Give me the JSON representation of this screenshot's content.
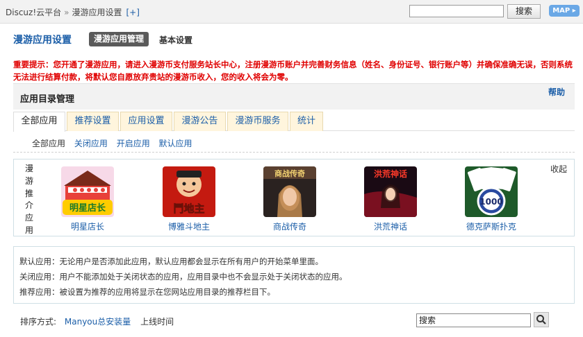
{
  "topbar": {
    "breadcrumb_root": "Discuz!云平台",
    "breadcrumb_sep": "»",
    "breadcrumb_current": "漫游应用设置",
    "add_label": "[+]",
    "search_placeholder": "",
    "search_button": "搜索",
    "map_button": "MAP ▸"
  },
  "header": {
    "page_title": "漫游应用设置",
    "tab_manage": "漫游应用管理",
    "tab_basic": "基本设置"
  },
  "notice": "重要提示：您开通了漫游应用，请进入漫游币支付服务站长中心，注册漫游币账户并完善财务信息（姓名、身份证号、银行账户等）并确保准确无误，否则系统无法进行结算付款，将默认您自愿放弃贵站的漫游币收入，您的收入将会为零。",
  "section": {
    "title": "应用目录管理",
    "help": "帮助"
  },
  "tabs": [
    {
      "label": "全部应用"
    },
    {
      "label": "推荐设置"
    },
    {
      "label": "应用设置"
    },
    {
      "label": "漫游公告"
    },
    {
      "label": "漫游币服务"
    },
    {
      "label": "统计"
    }
  ],
  "filters": [
    {
      "label": "全部应用"
    },
    {
      "label": "关闭应用"
    },
    {
      "label": "开启应用"
    },
    {
      "label": "默认应用"
    }
  ],
  "recommended": {
    "label_chars": [
      "漫",
      "游",
      "推",
      "介",
      "应",
      "用"
    ],
    "collapse": "收起",
    "apps": [
      {
        "name": "明星店长",
        "icon": "star-shop-icon"
      },
      {
        "name": "博雅斗地主",
        "icon": "doudizhu-icon"
      },
      {
        "name": "商战传奇",
        "icon": "business-legend-icon"
      },
      {
        "name": "洪荒神话",
        "icon": "myth-icon"
      },
      {
        "name": "德克萨斯扑克",
        "icon": "poker-icon"
      }
    ],
    "icon_texts": {
      "star_shop": "明星店长",
      "doudizhu": "鬥地主",
      "business": "商战传奇",
      "myth": "洪荒神话",
      "poker": "1000"
    }
  },
  "info": {
    "line1": "默认应用：无论用户是否添加此应用，默认应用都会显示在所有用户的开始菜单里面。",
    "line2": "关闭应用：用户不能添加处于关闭状态的应用，应用目录中也不会显示处于关闭状态的应用。",
    "line3": "推荐应用：被设置为推荐的应用将显示在您网站应用目录的推荐栏目下。"
  },
  "sort": {
    "label": "排序方式:",
    "option_installs": "Manyou总安装量",
    "option_time": "上线时间"
  },
  "bottom_search": {
    "value": "搜索"
  },
  "colors": {
    "link": "#1b5ea8",
    "notice": "#e00000",
    "tab_inactive_bg": "#fff5dd"
  }
}
